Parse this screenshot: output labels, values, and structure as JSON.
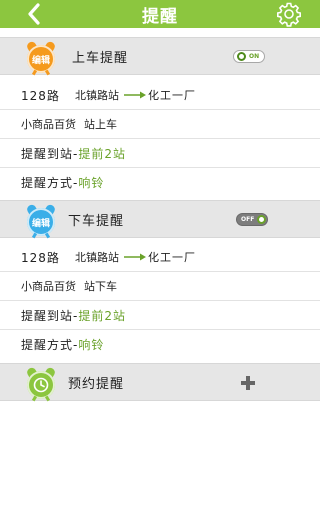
{
  "header": {
    "title": "提醒"
  },
  "sections": {
    "board": {
      "badge": "编辑",
      "label": "上车提醒",
      "toggle": "ON",
      "route": "128路",
      "from": "北镇路站",
      "to": "化工一厂",
      "stop_info_a": "小商品百货",
      "stop_info_b": "站上车",
      "arrive_label": "提醒到站-",
      "arrive_value": "提前2站",
      "mode_label": "提醒方式-",
      "mode_value": "响铃"
    },
    "alight": {
      "badge": "编辑",
      "label": "下车提醒",
      "toggle": "OFF",
      "route": "128路",
      "from": "北镇路站",
      "to": "化工一厂",
      "stop_info_a": "小商品百货",
      "stop_info_b": "站下车",
      "arrive_label": "提醒到站-",
      "arrive_value": "提前2站",
      "mode_label": "提醒方式-",
      "mode_value": "响铃"
    },
    "reserve": {
      "label": "预约提醒"
    }
  },
  "colors": {
    "accent": "#8cc63f",
    "value_green": "#6aa22a",
    "board_badge": "#f59a1d",
    "alight_badge": "#3aaee8",
    "reserve_badge": "#8cc63f"
  },
  "icons": {
    "back": "chevron-left-icon",
    "settings": "gear-icon",
    "alarm": "alarm-clock-icon",
    "add": "plus-icon",
    "route_arrow": "arrow-right-icon"
  }
}
